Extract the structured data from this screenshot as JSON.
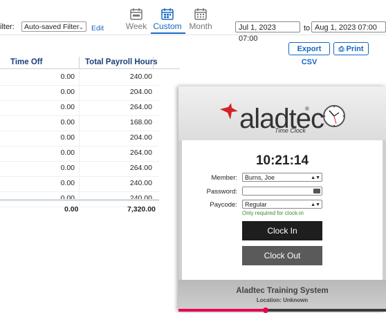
{
  "filter": {
    "label": "ilter:",
    "selected": "Auto-saved Filter",
    "edit": "Edit"
  },
  "modes": [
    {
      "label": "Week",
      "icon": "calendar-week-icon"
    },
    {
      "label": "Custom",
      "icon": "calendar-custom-icon",
      "active": true
    },
    {
      "label": "Month",
      "icon": "calendar-month-icon"
    }
  ],
  "date_range": {
    "start": "Jul 1, 2023 07:00",
    "to": "to",
    "end": "Aug 1, 2023 07:00"
  },
  "actions": {
    "export": "Export CSV",
    "print": "Print"
  },
  "table": {
    "headers": [
      "Time Off",
      "Total Payroll Hours"
    ],
    "rows": [
      [
        "0.00",
        "240.00"
      ],
      [
        "0.00",
        "204.00"
      ],
      [
        "0.00",
        "264.00"
      ],
      [
        "0.00",
        "168.00"
      ],
      [
        "0.00",
        "204.00"
      ],
      [
        "0.00",
        "264.00"
      ],
      [
        "0.00",
        "264.00"
      ],
      [
        "0.00",
        "240.00"
      ],
      [
        "0.00",
        "240.00"
      ]
    ],
    "totals": [
      "0.00",
      "7,320.00"
    ]
  },
  "time_clock": {
    "brand": "aladtec",
    "subtitle": "Time Clock",
    "time": "10:21:14",
    "member_label": "Member:",
    "member_value": "Burns, Joe",
    "password_label": "Password:",
    "password_value": "",
    "paycode_label": "Paycode:",
    "paycode_value": "Regular",
    "note": "Only required for clock-in",
    "clock_in": "Clock In",
    "clock_out": "Clock Out",
    "system_name": "Aladtec Training System",
    "location": "Location: Unknown"
  },
  "video_progress": 0.42,
  "colors": {
    "accent": "#1565c0",
    "header_text": "#1a3f7a",
    "note_green": "#3a8a2c",
    "progress": "#e5004f"
  }
}
